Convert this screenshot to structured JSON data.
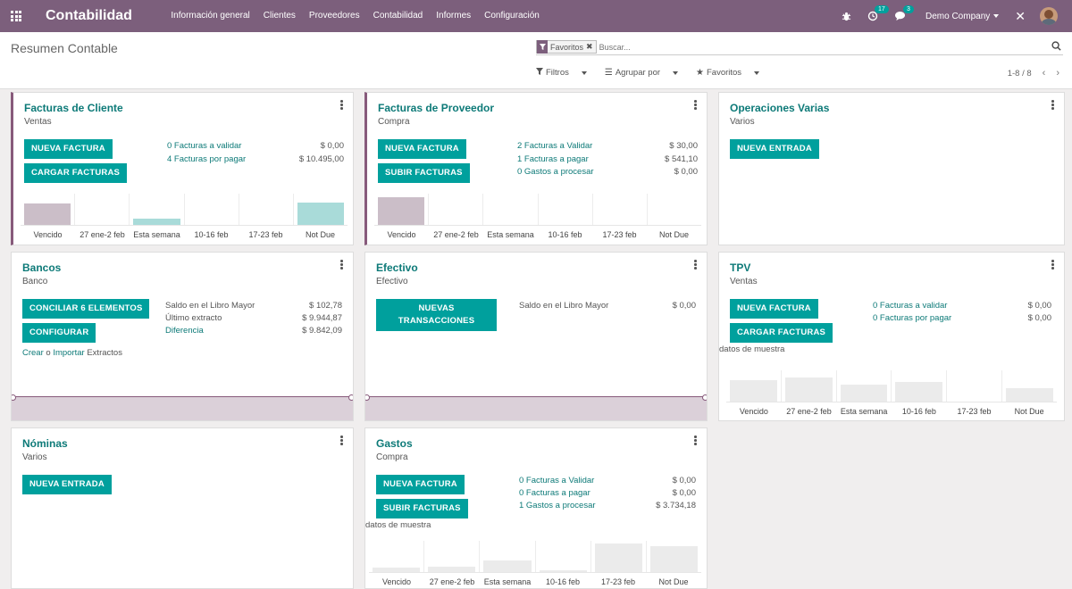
{
  "navbar": {
    "app_title": "Contabilidad",
    "menu": [
      "Información general",
      "Clientes",
      "Proveedores",
      "Contabilidad",
      "Informes",
      "Configuración"
    ],
    "activity_count": "17",
    "messages_count": "3",
    "company": "Demo Company",
    "color": "#7c5f7c"
  },
  "control": {
    "title": "Resumen Contable",
    "facet": "Favoritos",
    "search_placeholder": "Buscar...",
    "filters": "Filtros",
    "group_by": "Agrupar por",
    "favorites": "Favoritos",
    "pager": "1-8 / 8"
  },
  "colors": {
    "accent": "#00a09d",
    "brand": "#875a7b",
    "link": "#0d7a78"
  },
  "cards": {
    "customer_invoices": {
      "title": "Facturas de Cliente",
      "subtitle": "Ventas",
      "btn_new": "NUEVA FACTURA",
      "btn_upload": "CARGAR FACTURAS",
      "rows": [
        {
          "label": "0 Facturas a validar",
          "amount": "$ 0,00"
        },
        {
          "label": "4 Facturas por pagar",
          "amount": "$ 10.495,00"
        }
      ],
      "graph_labels": [
        "Vencido",
        "27 ene-2 feb",
        "Esta semana",
        "10-16 feb",
        "17-23 feb",
        "Not Due"
      ],
      "graph_values": [
        0.75,
        0,
        0.22,
        0,
        0,
        0.78
      ],
      "graph_colors": [
        "#cbbec8",
        "#cbbec8",
        "#a9dbd9",
        "#a9dbd9",
        "#a9dbd9",
        "#a9dbd9"
      ]
    },
    "vendor_bills": {
      "title": "Facturas de Proveedor",
      "subtitle": "Compra",
      "btn_new": "NUEVA FACTURA",
      "btn_upload": "SUBIR FACTURAS",
      "rows": [
        {
          "label": "2 Facturas a Validar",
          "amount": "$ 30,00"
        },
        {
          "label": "1 Facturas a pagar",
          "amount": "$ 541,10"
        },
        {
          "label": "0 Gastos a procesar",
          "amount": "$ 0,00"
        }
      ],
      "graph_labels": [
        "Vencido",
        "27 ene-2 feb",
        "Esta semana",
        "10-16 feb",
        "17-23 feb",
        "Not Due"
      ],
      "graph_values": [
        0.97,
        0,
        0,
        0,
        0,
        0
      ],
      "graph_colors": [
        "#cbbec8",
        "#cbbec8",
        "#cbbec8",
        "#cbbec8",
        "#cbbec8",
        "#cbbec8"
      ]
    },
    "misc_ops": {
      "title": "Operaciones Varias",
      "subtitle": "Varios",
      "btn_new": "NUEVA ENTRADA"
    },
    "banks": {
      "title": "Bancos",
      "subtitle": "Banco",
      "btn_reconcile": "CONCILIAR 6 ELEMENTOS",
      "btn_configure": "CONFIGURAR",
      "create": "Crear",
      "or": " o ",
      "import": "Importar",
      "statements": " Extractos",
      "rows": [
        {
          "label": "Saldo en el Libro Mayor",
          "amount": "$ 102,78"
        },
        {
          "label": "Último extracto",
          "amount": "$ 9.944,87"
        },
        {
          "label": "Diferencia",
          "amount": "$ 9.842,09"
        }
      ]
    },
    "cash": {
      "title": "Efectivo",
      "subtitle": "Efectivo",
      "btn_new": "NUEVAS TRANSACCIONES",
      "rows": [
        {
          "label": "Saldo en el Libro Mayor",
          "amount": "$ 0,00"
        }
      ]
    },
    "pos": {
      "title": "TPV",
      "subtitle": "Ventas",
      "btn_new": "NUEVA FACTURA",
      "btn_upload": "CARGAR FACTURAS",
      "sample": "datos de muestra",
      "rows": [
        {
          "label": "0 Facturas a validar",
          "amount": "$ 0,00"
        },
        {
          "label": "0 Facturas por pagar",
          "amount": "$ 0,00"
        }
      ],
      "graph_labels": [
        "Vencido",
        "27 ene-2 feb",
        "Esta semana",
        "10-16 feb",
        "17-23 feb",
        "Not Due"
      ],
      "graph_values": [
        0.75,
        0.85,
        0.6,
        0.7,
        0,
        0.48
      ],
      "graph_colors": [
        "#ebebeb",
        "#ebebeb",
        "#ebebeb",
        "#ebebeb",
        "#ebebeb",
        "#ebebeb"
      ]
    },
    "payroll": {
      "title": "Nóminas",
      "subtitle": "Varios",
      "btn_new": "NUEVA ENTRADA"
    },
    "expenses": {
      "title": "Gastos",
      "subtitle": "Compra",
      "btn_new": "NUEVA FACTURA",
      "btn_upload": "SUBIR FACTURAS",
      "sample": "datos de muestra",
      "rows": [
        {
          "label": "0 Facturas a Validar",
          "amount": "$ 0,00"
        },
        {
          "label": "0 Facturas a pagar",
          "amount": "$ 0,00"
        },
        {
          "label": "1 Gastos a procesar",
          "amount": "$ 3.734,18"
        }
      ],
      "graph_labels": [
        "Vencido",
        "27 ene-2 feb",
        "Esta semana",
        "10-16 feb",
        "17-23 feb",
        "Not Due"
      ],
      "graph_values": [
        0.15,
        0.2,
        0.42,
        0.06,
        1.0,
        0.92
      ],
      "graph_colors": [
        "#ebebeb",
        "#ebebeb",
        "#ebebeb",
        "#ebebeb",
        "#ebebeb",
        "#ebebeb"
      ]
    }
  }
}
